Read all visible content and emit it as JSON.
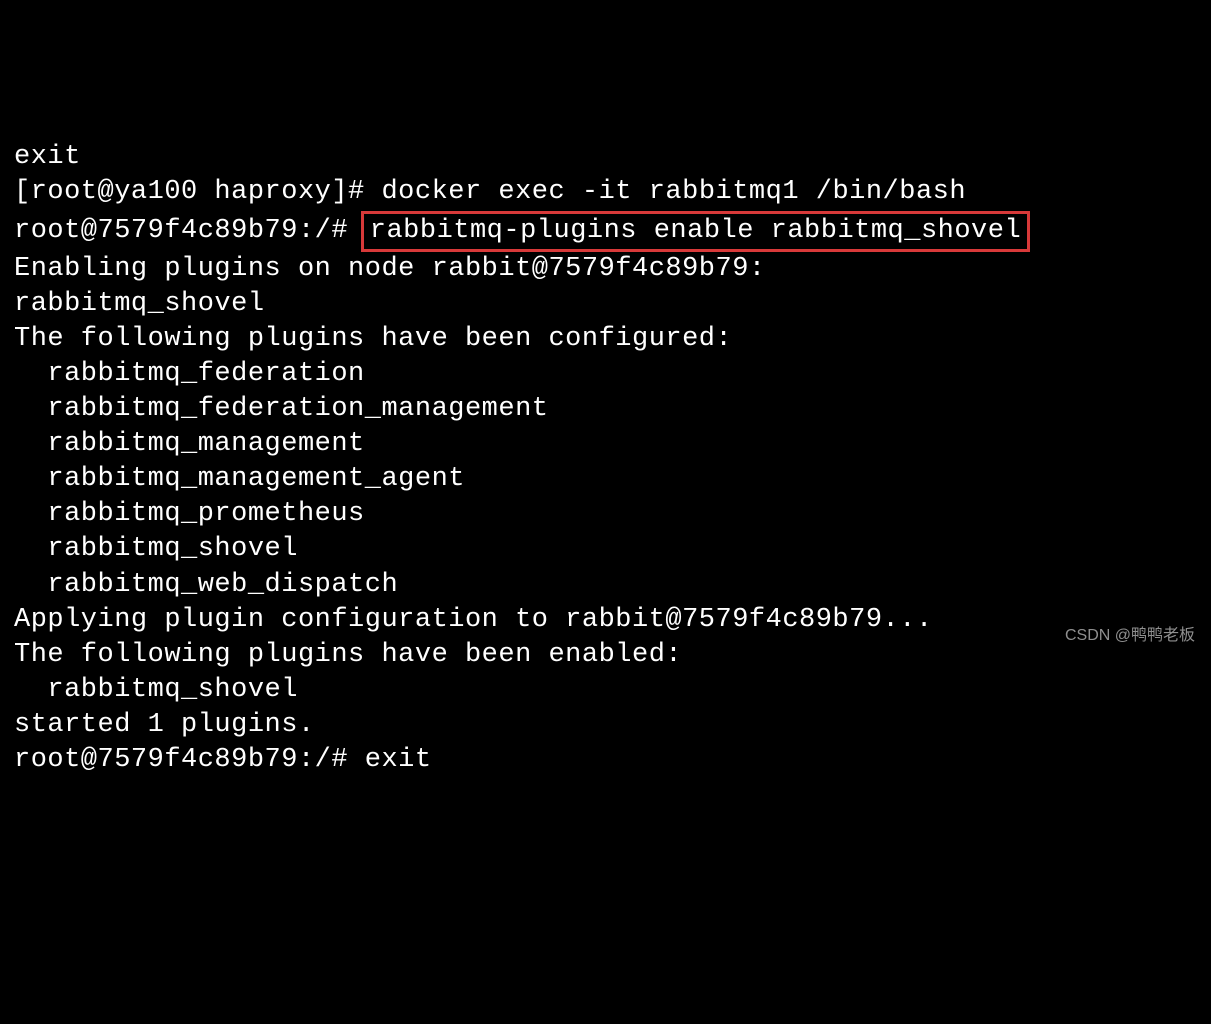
{
  "terminal": {
    "line0": "exit",
    "line1_prompt": "[root@ya100 haproxy]# ",
    "line1_cmd": "docker exec -it rabbitmq1 /bin/bash",
    "line2_prompt": "root@7579f4c89b79:/# ",
    "line2_cmd": "rabbitmq-plugins enable rabbitmq_shovel",
    "line3": "Enabling plugins on node rabbit@7579f4c89b79:",
    "line4": "rabbitmq_shovel",
    "line5": "The following plugins have been configured:",
    "line6": "  rabbitmq_federation",
    "line7": "  rabbitmq_federation_management",
    "line8": "  rabbitmq_management",
    "line9": "  rabbitmq_management_agent",
    "line10": "  rabbitmq_prometheus",
    "line11": "  rabbitmq_shovel",
    "line12": "  rabbitmq_web_dispatch",
    "line13": "Applying plugin configuration to rabbit@7579f4c89b79...",
    "line14": "The following plugins have been enabled:",
    "line15": "  rabbitmq_shovel",
    "line16": "",
    "line17": "started 1 plugins.",
    "line18_prompt": "root@7579f4c89b79:/# ",
    "line18_cmd": "exit"
  },
  "watermark": "CSDN @鸭鸭老板"
}
